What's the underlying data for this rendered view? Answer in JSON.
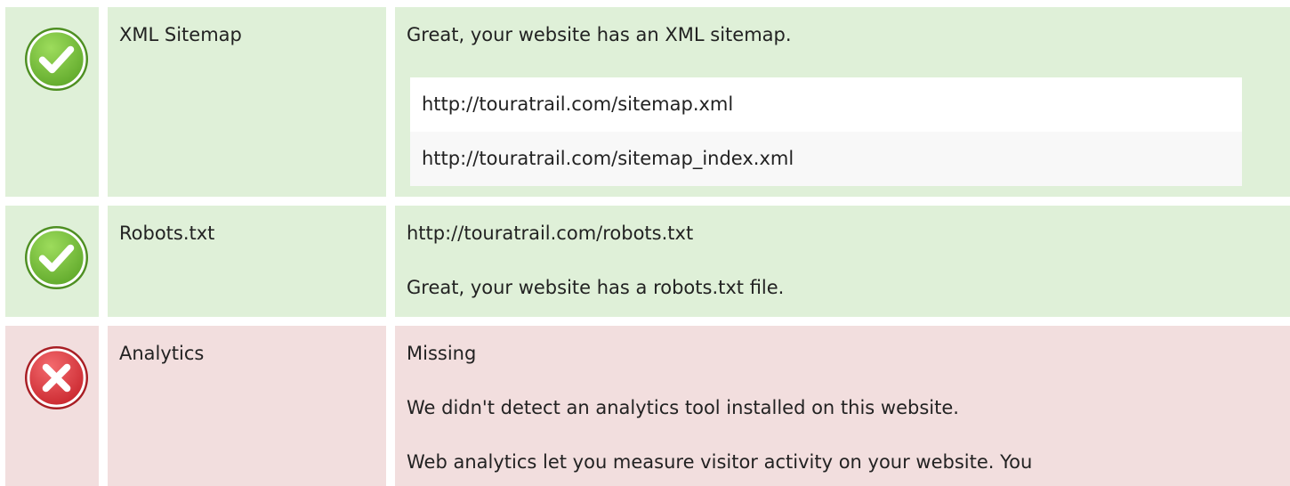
{
  "rows": [
    {
      "status": "pass",
      "status_icon": "check-circle-icon",
      "name": "XML Sitemap",
      "message": "Great, your website has an XML sitemap.",
      "urls": [
        "http://touratrail.com/sitemap.xml",
        "http://touratrail.com/sitemap_index.xml"
      ]
    },
    {
      "status": "pass",
      "status_icon": "check-circle-icon",
      "name": "Robots.txt",
      "url": "http://touratrail.com/robots.txt",
      "message": "Great, your website has a robots.txt file."
    },
    {
      "status": "fail",
      "status_icon": "cross-circle-icon",
      "name": "Analytics",
      "value": "Missing",
      "message": "We didn't detect an analytics tool installed on this website.",
      "detail": "Web analytics let you measure visitor activity on your website. You"
    }
  ],
  "colors": {
    "pass_bg": "#dff0d8",
    "fail_bg": "#f2dede",
    "pass_icon": "#7cc33f",
    "fail_icon": "#e0373f"
  }
}
